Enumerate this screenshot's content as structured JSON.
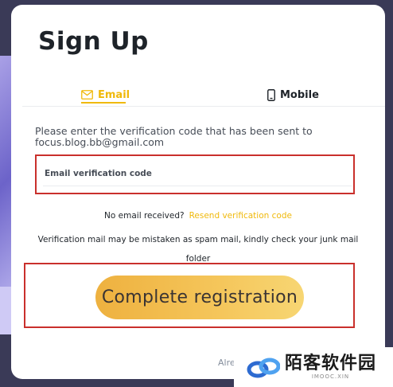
{
  "title": "Sign Up",
  "tabs": [
    {
      "label": "Email",
      "icon": "mail-icon",
      "active": true
    },
    {
      "label": "Mobile",
      "icon": "phone-icon",
      "active": false
    }
  ],
  "instruction": {
    "line1": "Please enter the verification code that has been sent to",
    "email": "focus.blog.bb@gmail.com"
  },
  "code_field": {
    "placeholder": "Email verification code",
    "value": ""
  },
  "resend": {
    "prompt": "No email received?",
    "link": "Resend verification code"
  },
  "spam_note": "Verification mail may be mistaken as spam mail, kindly check your junk mail folder",
  "submit_label": "Complete registration",
  "footer": {
    "text": "Alre"
  },
  "watermark": {
    "main": "陌客软件园",
    "sub": "IMOOC.XIN"
  },
  "colors": {
    "accent": "#f0b90b",
    "highlight_border": "#c9302c",
    "button": "#f5c65b"
  }
}
